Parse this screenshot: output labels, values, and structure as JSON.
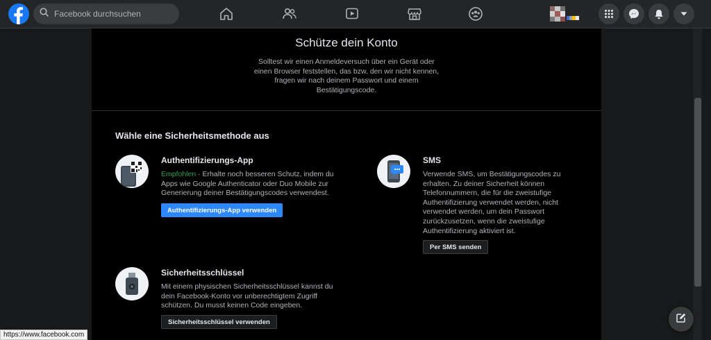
{
  "topbar": {
    "search_placeholder": "Facebook durchsuchen",
    "nav_icons": [
      "home-icon",
      "friends-icon",
      "watch-icon",
      "marketplace-icon",
      "groups-icon"
    ],
    "right_icons": [
      "menu-grid-icon",
      "messenger-icon",
      "notifications-icon",
      "account-dropdown-icon"
    ]
  },
  "page": {
    "title": "Schütze dein Konto",
    "subtitle": "Solltest wir einen Anmeldeversuch über ein Gerät oder einen Browser feststellen, das bzw. den wir nicht kennen, fragen wir nach deinem Passwort und einem Bestätigungscode."
  },
  "methods_heading": "Wähle eine Sicherheitsmethode aus",
  "methods": {
    "auth_app": {
      "title": "Authentifizierungs-App",
      "recommended": "Empfohlen",
      "description": " · Erhalte noch besseren Schutz, indem du Apps wie Google Authenticator oder Duo Mobile zur Generierung deiner Bestätigungscodes verwendest.",
      "button": "Authentifizierungs-App verwenden"
    },
    "sms": {
      "title": "SMS",
      "description": "Verwende SMS, um Bestätigungscodes zu erhalten. Zu deiner Sicherheit können Telefonnummern, die für die zweistufige Authentifizierung verwendet werden, nicht verwendet werden, um dein Passwort zurückzusetzen, wenn die zweistufige Authentifizierung aktiviert ist.",
      "button": "Per SMS senden"
    },
    "security_key": {
      "title": "Sicherheitsschlüssel",
      "description": "Mit einem physischen Sicherheitsschlüssel kannst du dein Facebook-Konto vor unberechtigtem Zugriff schützen. Du musst keinen Code eingeben.",
      "button": "Sicherheitsschlüssel verwenden"
    }
  },
  "statusbar": {
    "url": "https://www.facebook.com"
  },
  "colors": {
    "brand": "#1877f2",
    "primary_button": "#2d88ff",
    "recommended": "#31a24c",
    "topbar": "#242526",
    "panel": "#000000"
  }
}
